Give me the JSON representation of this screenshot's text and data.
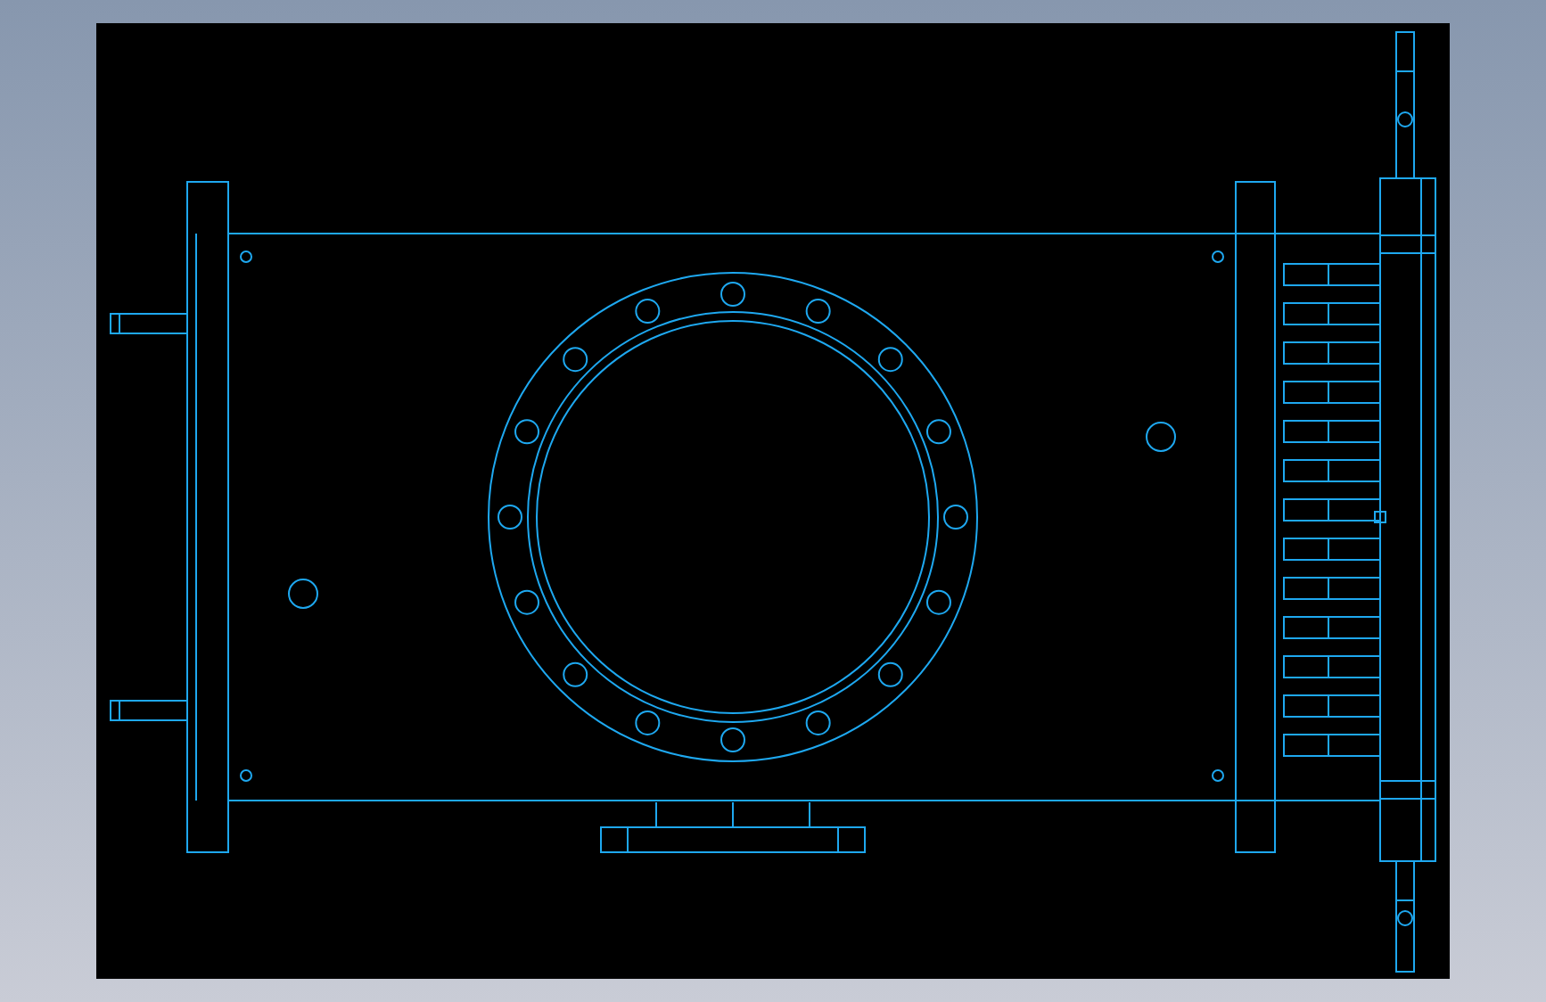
{
  "canvas": {
    "kind": "cad"
  }
}
